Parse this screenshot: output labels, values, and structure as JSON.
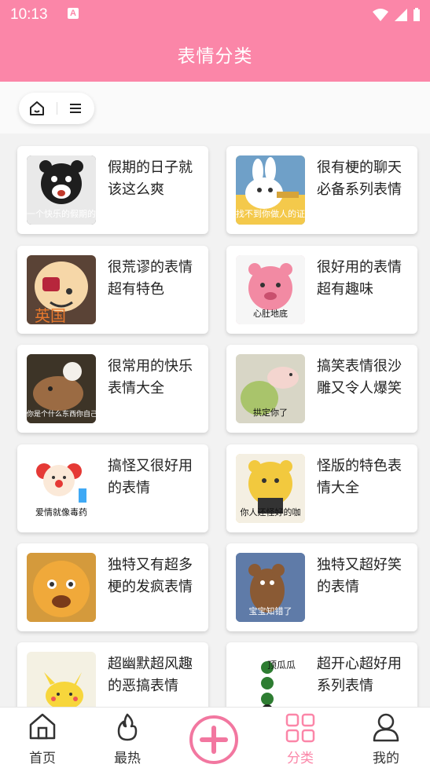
{
  "status": {
    "time": "10:13",
    "indicator": "A"
  },
  "header": {
    "title": "表情分类"
  },
  "toolbar": {
    "home_icon": "home-icon",
    "menu_icon": "menu-icon"
  },
  "categories": [
    {
      "title": "假期的日子就该这么爽",
      "caption": "一个快乐的假期的开始",
      "thumb_color": "#2a2a2a"
    },
    {
      "title": "很有梗的聊天必备系列表情",
      "caption": "找不到你做人的证据",
      "thumb_color": "#f4c94b"
    },
    {
      "title": "很荒谬的表情超有特色",
      "caption": "",
      "thumb_color": "#f5c7a3"
    },
    {
      "title": "很好用的表情超有趣味",
      "caption": "心肚地底",
      "thumb_color": "#f7b4c4"
    },
    {
      "title": "很常用的快乐表情大全",
      "caption": "你是个什么东西你自己清楚！",
      "thumb_color": "#6b4f3a"
    },
    {
      "title": "搞笑表情很沙雕又令人爆笑",
      "caption": "拱定你了",
      "thumb_color": "#d9d8c9"
    },
    {
      "title": "搞怪又很好用的表情",
      "caption": "爱情就像毒药",
      "thumb_color": "#ffffff"
    },
    {
      "title": "怪版的特色表情大全",
      "caption": "你人还怪好的咖",
      "thumb_color": "#f6d56f"
    },
    {
      "title": "独特又有超多梗的发疯表情",
      "caption": "",
      "thumb_color": "#e0a64a"
    },
    {
      "title": "独特又超好笑的表情",
      "caption": "宝宝知错了",
      "thumb_color": "#4a6a9c"
    },
    {
      "title": "超幽默超风趣的恶搞表情",
      "caption": "",
      "thumb_color": "#f7f5ea"
    },
    {
      "title": "超开心超好用系列表情",
      "caption": "顶瓜瓜",
      "thumb_color": "#ffffff"
    }
  ],
  "tabs": [
    {
      "label": "首页",
      "icon": "home-icon",
      "active": false
    },
    {
      "label": "最热",
      "icon": "flame-icon",
      "active": false
    },
    {
      "label": "",
      "icon": "plus-icon",
      "active": false
    },
    {
      "label": "分类",
      "icon": "grid-icon",
      "active": true
    },
    {
      "label": "我的",
      "icon": "user-icon",
      "active": false
    }
  ],
  "colors": {
    "accent": "#fb86a8",
    "text": "#222222",
    "active": "#fb86a8"
  }
}
